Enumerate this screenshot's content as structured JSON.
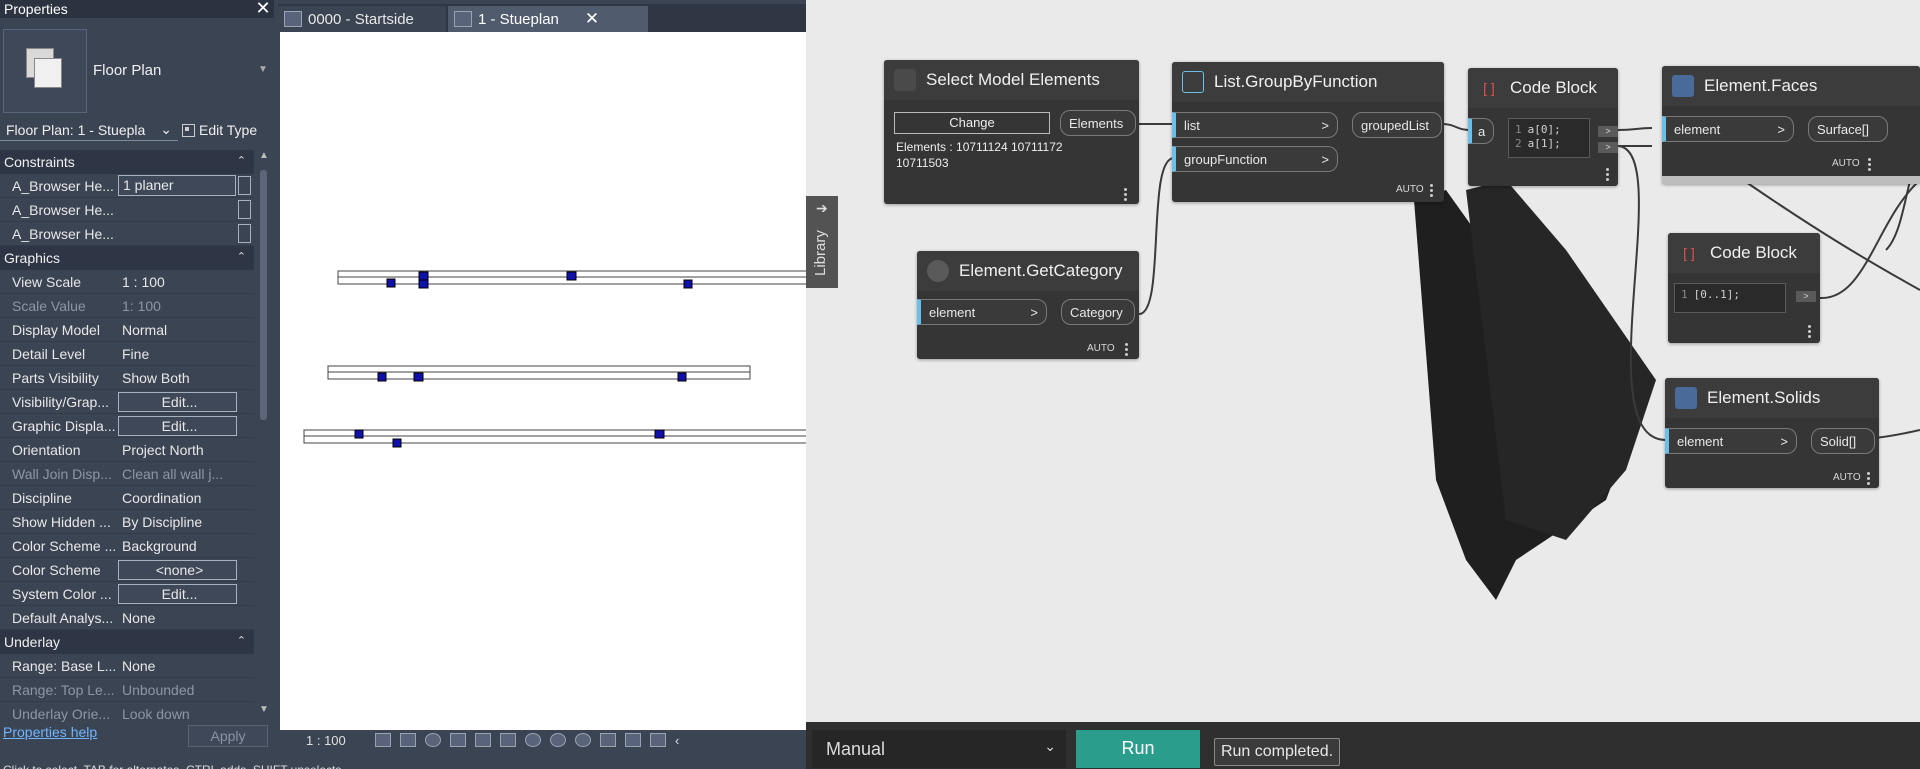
{
  "properties": {
    "title": "Properties",
    "type_name": "Floor Plan",
    "instance_selector": "Floor Plan: 1 - Stuepla",
    "edit_type": "Edit Type",
    "sections": {
      "constraints": "Constraints",
      "graphics": "Graphics",
      "underlay": "Underlay"
    },
    "constraints_rows": [
      {
        "name": "A_Browser He...",
        "value": "1 planer"
      },
      {
        "name": "A_Browser He...",
        "value": ""
      },
      {
        "name": "A_Browser He...",
        "value": ""
      }
    ],
    "graphics_rows": [
      {
        "name": "View Scale",
        "value": "1 : 100"
      },
      {
        "name": "Scale Value",
        "value": "1:  100"
      },
      {
        "name": "Display Model",
        "value": "Normal"
      },
      {
        "name": "Detail Level",
        "value": "Fine"
      },
      {
        "name": "Parts Visibility",
        "value": "Show Both"
      },
      {
        "name": "Visibility/Grap...",
        "value": "Edit..."
      },
      {
        "name": "Graphic Displa...",
        "value": "Edit..."
      },
      {
        "name": "Orientation",
        "value": "Project North"
      },
      {
        "name": "Wall Join Disp...",
        "value": "Clean all wall j..."
      },
      {
        "name": "Discipline",
        "value": "Coordination"
      },
      {
        "name": "Show Hidden ...",
        "value": "By Discipline"
      },
      {
        "name": "Color Scheme ...",
        "value": "Background"
      },
      {
        "name": "Color Scheme",
        "value": "<none>"
      },
      {
        "name": "System Color ...",
        "value": "Edit..."
      },
      {
        "name": "Default Analys...",
        "value": "None"
      }
    ],
    "underlay_rows": [
      {
        "name": "Range: Base L...",
        "value": "None"
      },
      {
        "name": "Range: Top Le...",
        "value": "Unbounded"
      },
      {
        "name": "Underlay Orie...",
        "value": "Look down"
      }
    ],
    "help_link": "Properties help",
    "apply": "Apply"
  },
  "view_tabs": [
    {
      "label": "0000 - Startside"
    },
    {
      "label": "1 - Stueplan"
    }
  ],
  "view_scale": "1 : 100",
  "status_text": "Click to select, TAB for alternates, CTRL adds, SHIFT unselects.",
  "dynamo": {
    "library_label": "Library",
    "nodes": {
      "select_model_elements": {
        "title": "Select Model Elements",
        "change": "Change",
        "output": "Elements",
        "info_line1": "Elements : 10711124 10711172",
        "info_line2": "10711503"
      },
      "get_category": {
        "title": "Element.GetCategory",
        "input": "element",
        "output": "Category",
        "lacing": "AUTO"
      },
      "group_by_function": {
        "title": "List.GroupByFunction",
        "input1": "list",
        "input2": "groupFunction",
        "output": "groupedList",
        "lacing": "AUTO"
      },
      "code_block_1": {
        "title": "Code Block",
        "input": "a",
        "line1": "a[0];",
        "line2": "a[1];"
      },
      "element_faces": {
        "title": "Element.Faces",
        "input": "element",
        "output": "Surface[]",
        "lacing": "AUTO"
      },
      "code_block_2": {
        "title": "Code Block",
        "line1": "[0..1];"
      },
      "element_solids": {
        "title": "Element.Solids",
        "input": "element",
        "output": "Solid[]",
        "lacing": "AUTO"
      }
    },
    "run_mode": "Manual",
    "run_button": "Run",
    "run_status": "Run completed."
  },
  "colors": {
    "revit_panel": "#3b4453",
    "dynamo_canvas": "#eaeaea",
    "node_body": "#353535",
    "run_button": "#2b9d8c",
    "port_accent": "#6ac0e8"
  }
}
